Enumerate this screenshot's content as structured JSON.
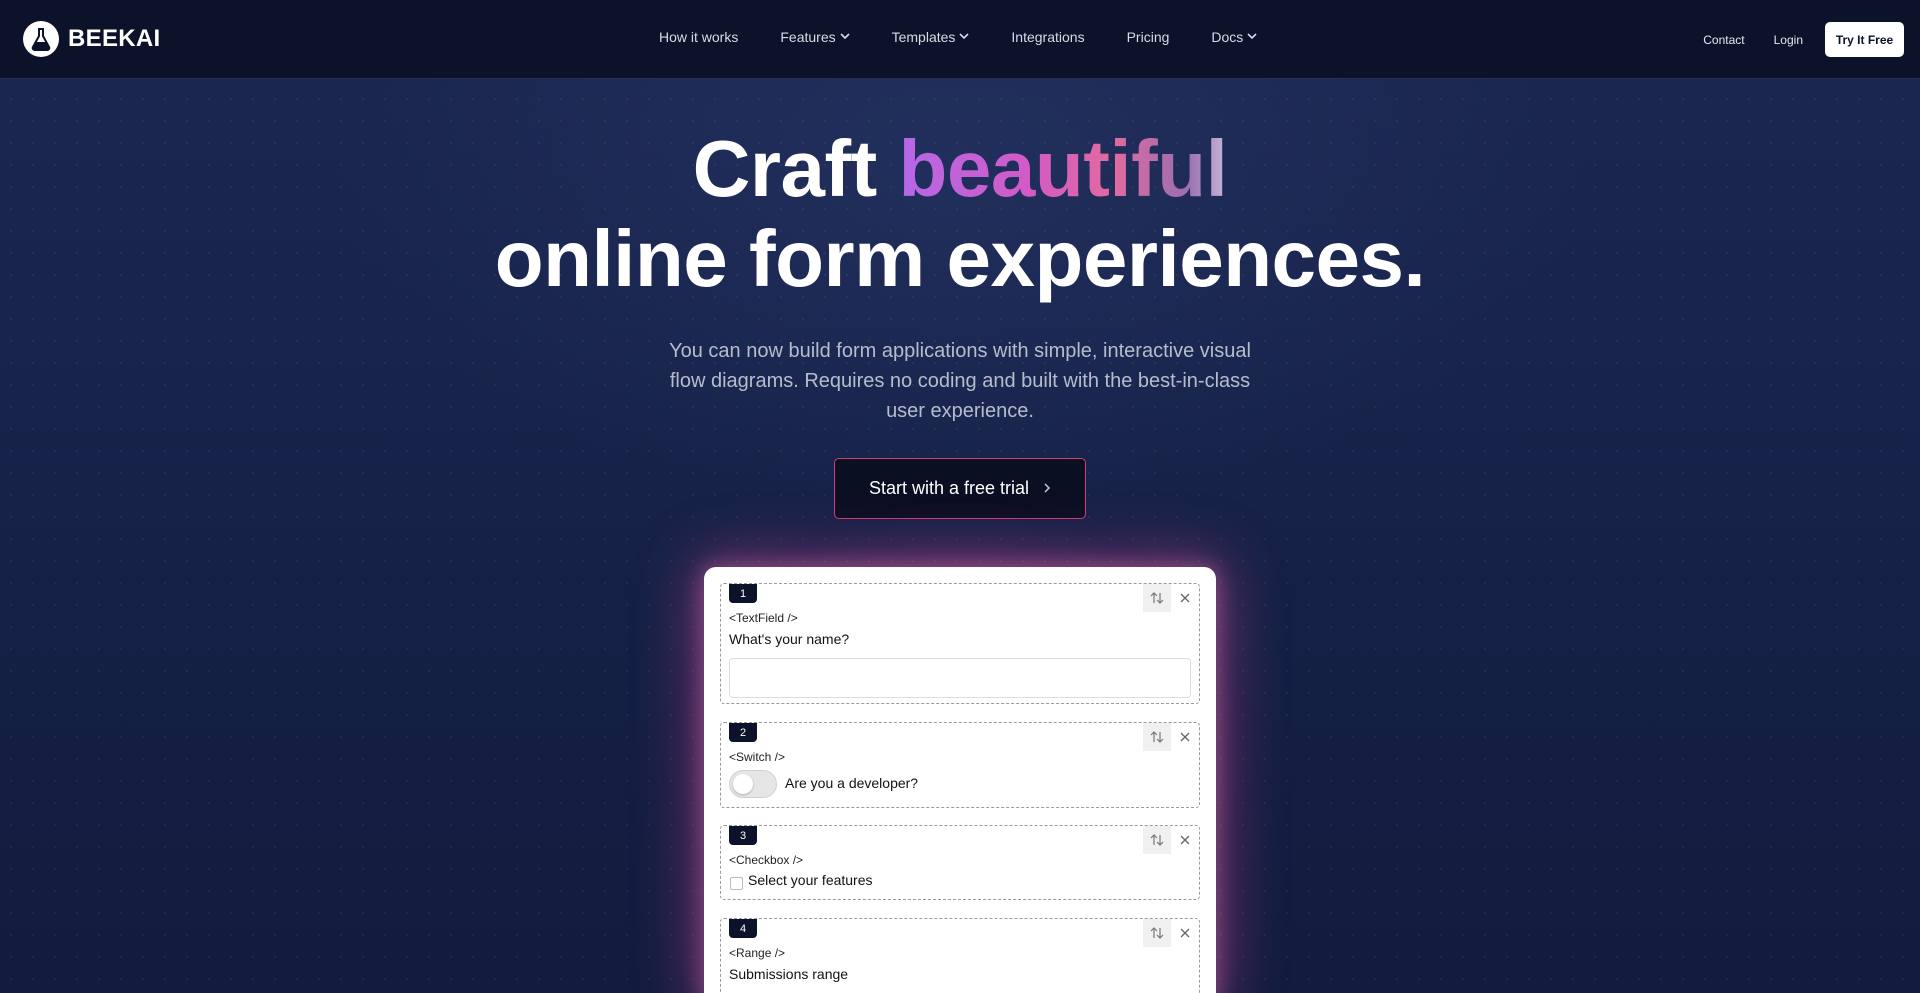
{
  "brand": {
    "name": "BEEKAI"
  },
  "nav": {
    "links": [
      {
        "label": "How it works",
        "dropdown": false
      },
      {
        "label": "Features",
        "dropdown": true
      },
      {
        "label": "Templates",
        "dropdown": true
      },
      {
        "label": "Integrations",
        "dropdown": false
      },
      {
        "label": "Pricing",
        "dropdown": false
      },
      {
        "label": "Docs",
        "dropdown": true
      }
    ],
    "contact": "Contact",
    "login": "Login",
    "try_free": "Try It Free"
  },
  "hero": {
    "line1_plain": "Craft",
    "line1_highlight": "beautiful",
    "line2": "online form experiences.",
    "subtitle": "You can now build form applications with simple, interactive visual flow diagrams. Requires no coding and built with the best-in-class user experience.",
    "cta": "Start with a free trial",
    "cta_icon": "chevron-right-icon"
  },
  "form": {
    "fields": [
      {
        "index": "1",
        "tag": "<TextField />",
        "label": "What's your name?",
        "type": "text",
        "value": ""
      },
      {
        "index": "2",
        "tag": "<Switch />",
        "label": "Are you a developer?",
        "type": "switch",
        "checked": false
      },
      {
        "index": "3",
        "tag": "<Checkbox />",
        "label": "Select your features",
        "type": "checkbox",
        "checked": false
      },
      {
        "index": "4",
        "tag": "<Range />",
        "label": "Submissions range",
        "type": "range"
      }
    ]
  },
  "colors": {
    "nav_bg": "#0b1229",
    "page_bg": "#17234a",
    "cta_border": "#d03d72",
    "accent_gradient": [
      "#b568e8",
      "#d25bc5",
      "#e26aa0",
      "#9a6fb0"
    ]
  }
}
